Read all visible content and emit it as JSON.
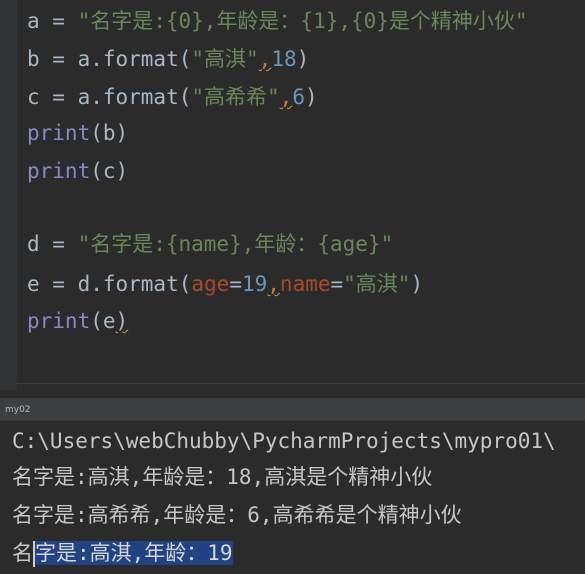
{
  "editor": {
    "lines": [
      {
        "parts": [
          {
            "t": "a = ",
            "c": "plain"
          },
          {
            "t": "\"名字是:{0},年龄是：{1},{0}是个精神小伙\"",
            "c": "str"
          }
        ]
      },
      {
        "parts": [
          {
            "t": "b = a.format(",
            "c": "plain"
          },
          {
            "t": "\"高淇\"",
            "c": "str"
          },
          {
            "t": ",",
            "c": "kw squig"
          },
          {
            "t": "18",
            "c": "num"
          },
          {
            "t": ")",
            "c": "plain"
          }
        ]
      },
      {
        "parts": [
          {
            "t": "c = a.format(",
            "c": "plain"
          },
          {
            "t": "\"高希希\"",
            "c": "str"
          },
          {
            "t": ",",
            "c": "kw squig"
          },
          {
            "t": "6",
            "c": "num"
          },
          {
            "t": ")",
            "c": "plain"
          }
        ]
      },
      {
        "parts": [
          {
            "t": "print",
            "c": "fn"
          },
          {
            "t": "(b)",
            "c": "plain"
          }
        ]
      },
      {
        "parts": [
          {
            "t": "print",
            "c": "fn"
          },
          {
            "t": "(c)",
            "c": "plain"
          }
        ]
      },
      {
        "parts": []
      },
      {
        "parts": [
          {
            "t": "d = ",
            "c": "plain"
          },
          {
            "t": "\"名字是:{name},年龄：{age}\"",
            "c": "str"
          }
        ]
      },
      {
        "parts": [
          {
            "t": "e = d.format(",
            "c": "plain"
          },
          {
            "t": "age",
            "c": "param"
          },
          {
            "t": "=",
            "c": "plain"
          },
          {
            "t": "19",
            "c": "num"
          },
          {
            "t": ",",
            "c": "kw squig"
          },
          {
            "t": "name",
            "c": "param"
          },
          {
            "t": "=",
            "c": "plain"
          },
          {
            "t": "\"高淇\"",
            "c": "str"
          },
          {
            "t": ")",
            "c": "plain"
          }
        ]
      },
      {
        "parts": [
          {
            "t": "print",
            "c": "fn"
          },
          {
            "t": "(e",
            "c": "plain"
          },
          {
            "t": ")",
            "c": "plain squig"
          }
        ]
      }
    ]
  },
  "run_panel": {
    "tab_label": "my02"
  },
  "console": {
    "command_line": "C:\\Users\\webChubby\\PycharmProjects\\mypro01\\",
    "output_1": "名字是:高淇,年龄是：18,高淇是个精神小伙",
    "output_2": "名字是:高希希,年龄是：6,高希希是个精神小伙",
    "output_3_unselected": "名",
    "output_3_selected": "字是:高淇,年龄：19"
  },
  "colors": {
    "background": "#2b2b2b",
    "string": "#6a8759",
    "number": "#6897bb",
    "keyword": "#cc7832",
    "builtin": "#8888c6",
    "parameter": "#aa4926",
    "selection": "#214283"
  }
}
